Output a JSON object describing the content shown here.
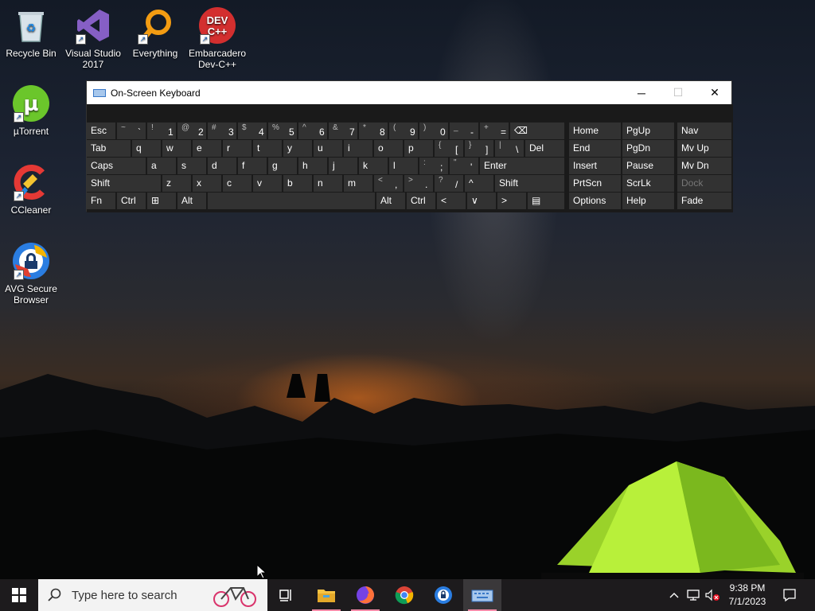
{
  "desktop": {
    "icons": [
      {
        "label": "Recycle Bin",
        "icon": "recycle-bin-icon"
      },
      {
        "label": "Visual Studio 2017",
        "icon": "visual-studio-icon"
      },
      {
        "label": "Everything",
        "icon": "everything-search-icon"
      },
      {
        "label": "Embarcadero Dev-C++",
        "icon": "devcpp-icon",
        "logo_text": "DEV C++"
      },
      {
        "label": "µTorrent",
        "icon": "utorrent-icon"
      },
      {
        "label": "CCleaner",
        "icon": "ccleaner-icon"
      },
      {
        "label": "AVG Secure Browser",
        "icon": "avg-browser-icon"
      }
    ]
  },
  "osk": {
    "title": "On-Screen Keyboard",
    "title_icon": "keyboard-icon",
    "controls": {
      "minimize": "─",
      "maximize": "☐",
      "close": "✕"
    },
    "rows": {
      "row1": [
        {
          "main": "Esc"
        },
        {
          "shift": "~",
          "main": "`"
        },
        {
          "shift": "!",
          "main": "1"
        },
        {
          "shift": "@",
          "main": "2"
        },
        {
          "shift": "#",
          "main": "3"
        },
        {
          "shift": "$",
          "main": "4"
        },
        {
          "shift": "%",
          "main": "5"
        },
        {
          "shift": "^",
          "main": "6"
        },
        {
          "shift": "&",
          "main": "7"
        },
        {
          "shift": "*",
          "main": "8"
        },
        {
          "shift": "(",
          "main": "9"
        },
        {
          "shift": ")",
          "main": "0"
        },
        {
          "shift": "_",
          "main": "-"
        },
        {
          "shift": "+",
          "main": "="
        },
        {
          "main": "⌫"
        }
      ],
      "row2": [
        "Tab",
        "q",
        "w",
        "e",
        "r",
        "t",
        "y",
        "u",
        "i",
        "o",
        "p",
        {
          "shift": "{",
          "main": "["
        },
        {
          "shift": "}",
          "main": "]"
        },
        {
          "shift": "|",
          "main": "\\"
        },
        "Del"
      ],
      "row3": [
        "Caps",
        "a",
        "s",
        "d",
        "f",
        "g",
        "h",
        "j",
        "k",
        "l",
        {
          "shift": ":",
          "main": ";"
        },
        {
          "shift": "\"",
          "main": "'"
        },
        "Enter"
      ],
      "row4": [
        "Shift",
        "z",
        "x",
        "c",
        "v",
        "b",
        "n",
        "m",
        {
          "shift": "<",
          "main": ","
        },
        {
          "shift": ">",
          "main": "."
        },
        {
          "shift": "?",
          "main": "/"
        },
        "^",
        "Shift"
      ],
      "row5": [
        "Fn",
        "Ctrl",
        "⊞",
        "Alt",
        "",
        "Alt",
        "Ctrl",
        "<",
        "∨",
        ">",
        "▤"
      ]
    },
    "nav": {
      "col1": [
        "Home",
        "End",
        "Insert",
        "PrtScn",
        "Options"
      ],
      "col2": [
        "PgUp",
        "PgDn",
        "Pause",
        "ScrLk",
        "Help"
      ],
      "col3": [
        "Nav",
        "Mv Up",
        "Mv Dn",
        "Dock",
        "Fade"
      ]
    }
  },
  "taskbar": {
    "search_placeholder": "Type here to search",
    "apps": [
      "task-view",
      "file-explorer",
      "firefox",
      "chrome",
      "avg-browser",
      "on-screen-keyboard"
    ],
    "time": "9:38 PM",
    "date": "7/1/2023"
  }
}
